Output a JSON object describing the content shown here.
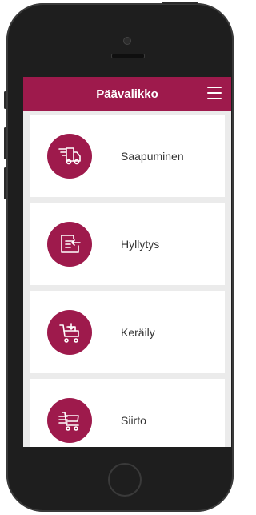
{
  "appbar": {
    "title": "Päävalikko",
    "menu_icon": "hamburger-menu-icon"
  },
  "tiles": [
    {
      "label": "Saapuminen",
      "icon": "truck-icon"
    },
    {
      "label": "Hyllytys",
      "icon": "shelving-icon"
    },
    {
      "label": "Keräily",
      "icon": "picking-cart-icon"
    },
    {
      "label": "Siirto",
      "icon": "transfer-cart-icon"
    }
  ],
  "colors": {
    "accent": "#9e1a4c",
    "background": "#ebebeb",
    "phone": "#1e1e1e"
  }
}
